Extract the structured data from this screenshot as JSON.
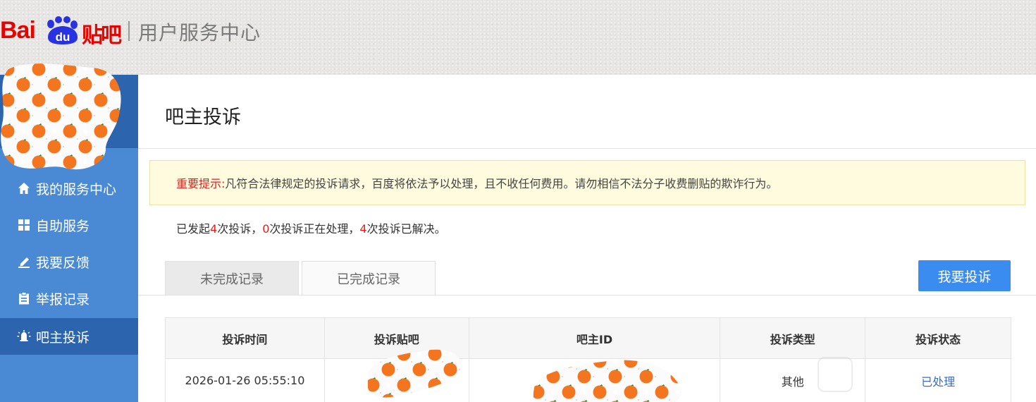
{
  "header": {
    "logo_bai": "Bai",
    "logo_du": "du",
    "logo_tieba": "贴吧",
    "title": "用户服务中心"
  },
  "sidebar": {
    "items": [
      {
        "label": "我的服务中心",
        "icon": "home-icon"
      },
      {
        "label": "自助服务",
        "icon": "grid-icon"
      },
      {
        "label": "我要反馈",
        "icon": "edit-icon"
      },
      {
        "label": "举报记录",
        "icon": "clipboard-icon"
      },
      {
        "label": "吧主投诉",
        "icon": "alarm-icon",
        "active": true
      }
    ]
  },
  "main": {
    "page_title": "吧主投诉",
    "notice_label": "重要提示:",
    "notice_text": "凡符合法律规定的投诉请求，百度将依法予以处理，且不收任何费用。请勿相信不法分子收费删贴的欺诈行为。",
    "summary": {
      "prefix": "已发起",
      "total": "4",
      "part1": "次投诉，",
      "processing": "0",
      "part2": "次投诉正在处理，",
      "resolved": "4",
      "part3": "次投诉已解决。"
    },
    "tabs": [
      {
        "label": "未完成记录"
      },
      {
        "label": "已完成记录",
        "active": true
      }
    ],
    "complain_button": "我要投诉",
    "table": {
      "headers": [
        "投诉时间",
        "投诉贴吧",
        "吧主ID",
        "投诉类型",
        "投诉状态"
      ],
      "rows": [
        {
          "time": "2026-01-26 05:55:10",
          "forum": "",
          "owner_id": "",
          "type": "其他",
          "status": "已处理"
        }
      ]
    }
  },
  "colors": {
    "brand_red": "#e10602",
    "sidebar_blue": "#4a8ad4",
    "sidebar_active": "#2c64ad",
    "button_blue": "#3b8cf0",
    "notice_bg": "#fefbde",
    "highlight_red": "#e02020"
  }
}
